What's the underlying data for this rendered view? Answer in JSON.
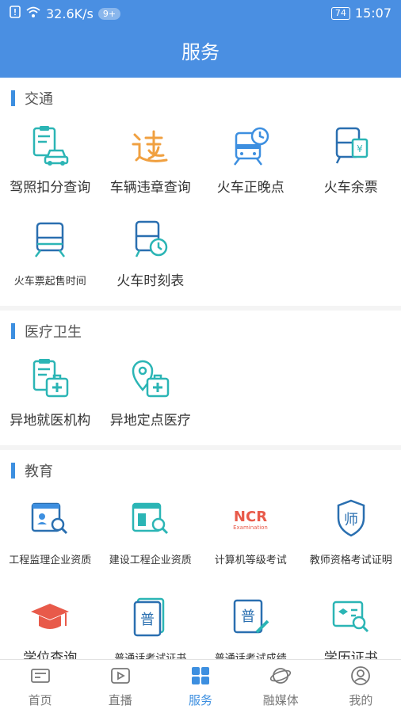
{
  "status_bar": {
    "speed": "32.6K/s",
    "badge": "9+",
    "battery": "74",
    "time": "15:07"
  },
  "header": {
    "title": "服务"
  },
  "sections": [
    {
      "title": "交通",
      "items": [
        {
          "label": "驾照扣分查询",
          "icon": "license-car-icon"
        },
        {
          "label": "车辆违章查询",
          "icon": "violation-icon"
        },
        {
          "label": "火车正晚点",
          "icon": "train-clock-icon"
        },
        {
          "label": "火车余票",
          "icon": "train-ticket-icon"
        },
        {
          "label": "火车票起售时间",
          "icon": "train-icon"
        },
        {
          "label": "火车时刻表",
          "icon": "train-timetable-icon"
        }
      ]
    },
    {
      "title": "医疗卫生",
      "items": [
        {
          "label": "异地就医机构",
          "icon": "medical-clipboard-icon"
        },
        {
          "label": "异地定点医疗",
          "icon": "medical-location-icon"
        }
      ]
    },
    {
      "title": "教育",
      "items": [
        {
          "label": "工程监理企业资质",
          "icon": "engineer-search-icon"
        },
        {
          "label": "建设工程企业资质",
          "icon": "building-search-icon"
        },
        {
          "label": "计算机等级考试",
          "icon": "ncre-logo-icon",
          "logo_text": "NCR",
          "logo_subtext": "Examination"
        },
        {
          "label": "教师资格考试证明",
          "icon": "teacher-shield-icon",
          "glyph": "师"
        },
        {
          "label": "学位查询",
          "icon": "graduation-cap-icon"
        },
        {
          "label": "普通话考试证书",
          "icon": "mandarin-cert-icon",
          "glyph": "普"
        },
        {
          "label": "普通话考试成绩",
          "icon": "mandarin-score-icon",
          "glyph": "普"
        },
        {
          "label": "学历证书",
          "icon": "diploma-search-icon"
        }
      ]
    }
  ],
  "tabs": [
    {
      "label": "首页",
      "icon": "home-icon"
    },
    {
      "label": "直播",
      "icon": "play-icon"
    },
    {
      "label": "服务",
      "icon": "grid-icon",
      "active": true
    },
    {
      "label": "融媒体",
      "icon": "planet-icon"
    },
    {
      "label": "我的",
      "icon": "user-icon"
    }
  ],
  "colors": {
    "primary": "#4a8fe2",
    "accent": "#3d8fe0",
    "teal": "#2bb5b5",
    "orange": "#f0a040",
    "red": "#e85a4a"
  }
}
